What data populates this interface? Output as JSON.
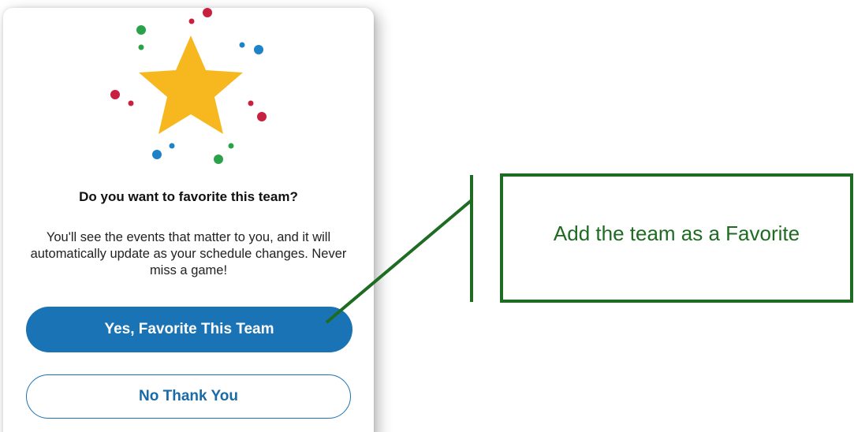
{
  "dialog": {
    "title": "Do you want to favorite this team?",
    "message": "You'll see the events that matter to you, and it will automatically update as your schedule changes. Never miss a game!",
    "primary_button": "Yes, Favorite This Team",
    "secondary_button": "No Thank You"
  },
  "illustration": {
    "icon": "star-icon",
    "star_color": "#F6B81E",
    "confetti_colors": [
      "#C8203F",
      "#2BA24A",
      "#1E82C8"
    ]
  },
  "annotation": {
    "label": "Add the team as a Favorite",
    "color": "#1E6B22"
  },
  "colors": {
    "accent": "#1A73B5"
  }
}
